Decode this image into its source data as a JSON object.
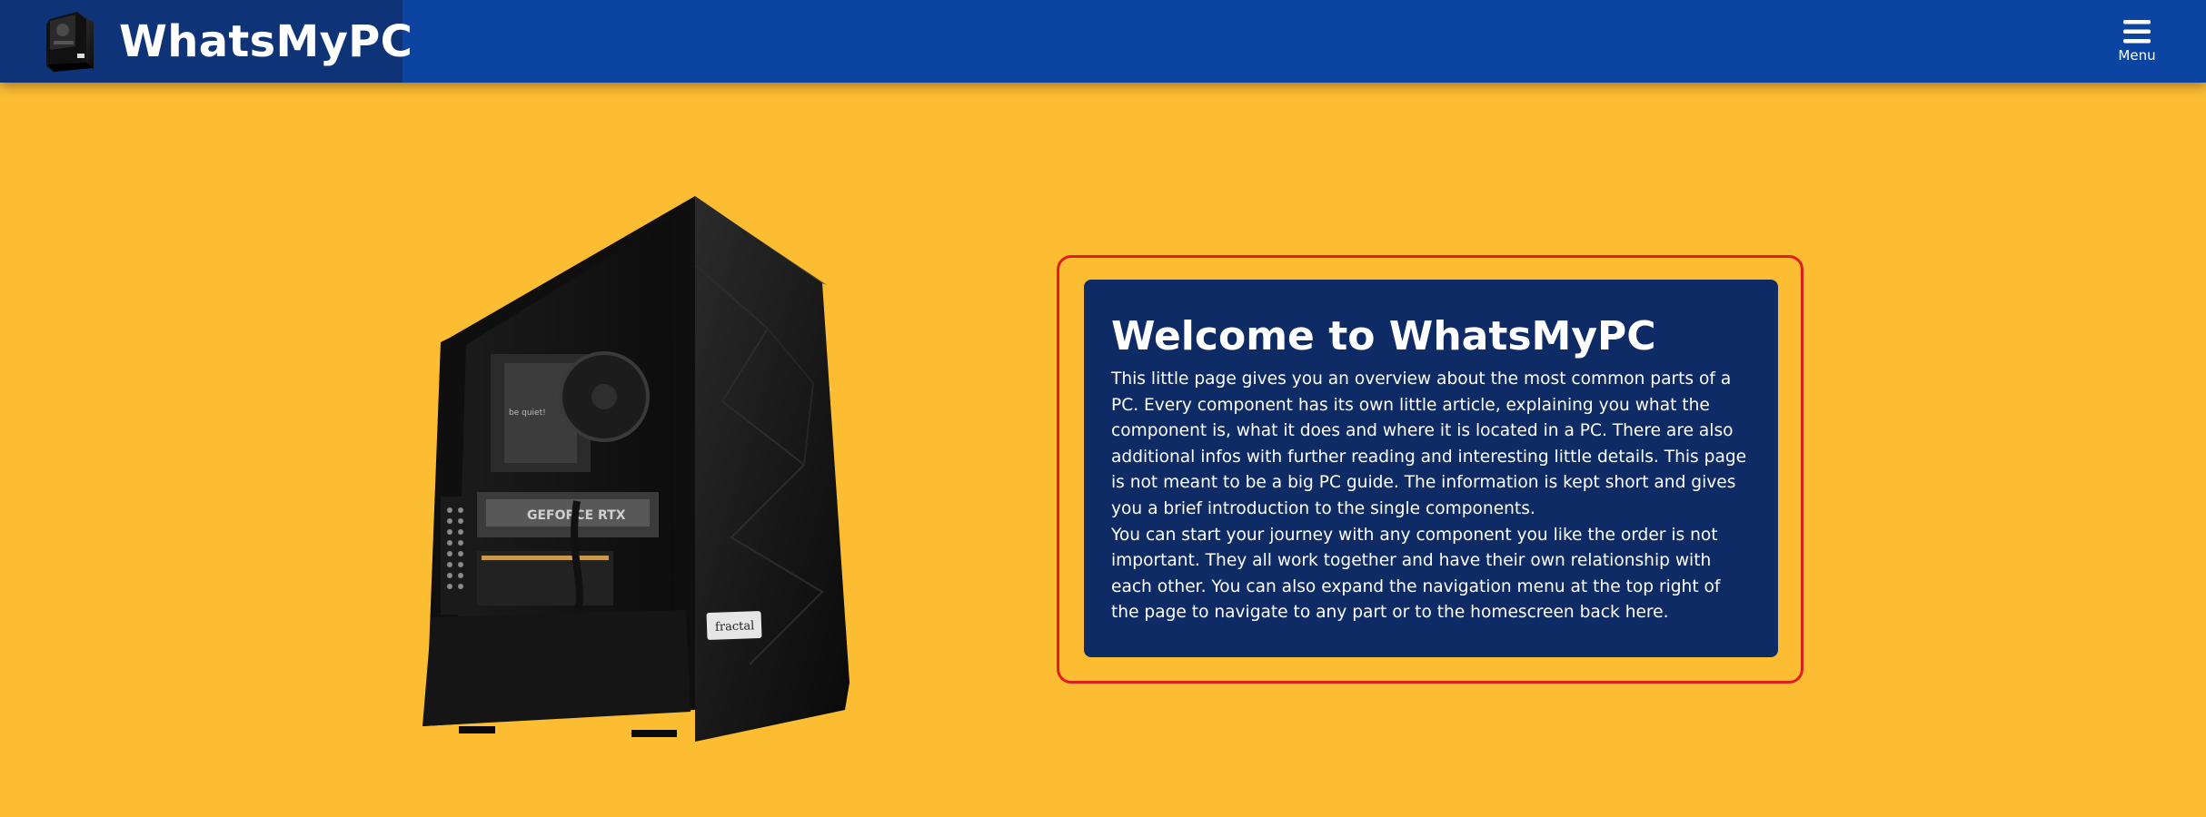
{
  "header": {
    "brand_name": "WhatsMyPC",
    "brand_logo_icon": "pc-case-logo-icon",
    "menu_label": "Menu",
    "menu_icon": "hamburger-menu-icon",
    "colors": {
      "bar": "#0c44a2",
      "brand_block": "#0e3477"
    }
  },
  "hero": {
    "image": "pc-case-image",
    "image_case_label": "fractal",
    "image_gpu_label": "GEFORCE RTX",
    "image_cooler_label": "be quiet!"
  },
  "welcome": {
    "title": "Welcome to WhatsMyPC",
    "paragraph_1": "This little page gives you an overview about the most common parts of a PC. Every component has its own little article, explaining you what the component is, what it does and where it is located in a PC. There are also additional infos with further reading and interesting little details. This page is not meant to be a big PC guide. The information is kept short and gives you a brief introduction to the single components.",
    "paragraph_2": "You can start your journey with any component you like the order is not important. They all work together and have their own relationship with each other. You can also expand the navigation menu at the top right of the page to navigate to any part or to the homescreen back here.",
    "colors": {
      "card": "#0e2b66",
      "highlight_border": "#e01e1e",
      "page_background": "#fdbd33"
    }
  }
}
